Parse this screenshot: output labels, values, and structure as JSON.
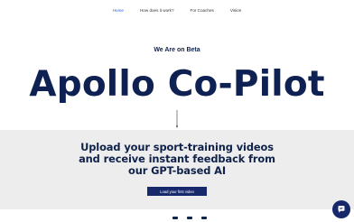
{
  "nav": {
    "items": [
      {
        "label": "Home",
        "active": true
      },
      {
        "label": "How does it work?",
        "active": false
      },
      {
        "label": "For Coaches",
        "active": false
      },
      {
        "label": "Vision",
        "active": false
      }
    ]
  },
  "hero": {
    "beta_label": "We Are on Beta",
    "title": "Apollo Co-Pilot"
  },
  "upload_section": {
    "headline": "Upload your sport-training videos and receive instant feedback from our GPT-based AI",
    "cta_label": "Load your first video"
  },
  "chat": {
    "icon": "chat-icon"
  },
  "colors": {
    "brand": "#17296a",
    "accent": "#2b5fd9",
    "section_bg": "#ededed"
  }
}
